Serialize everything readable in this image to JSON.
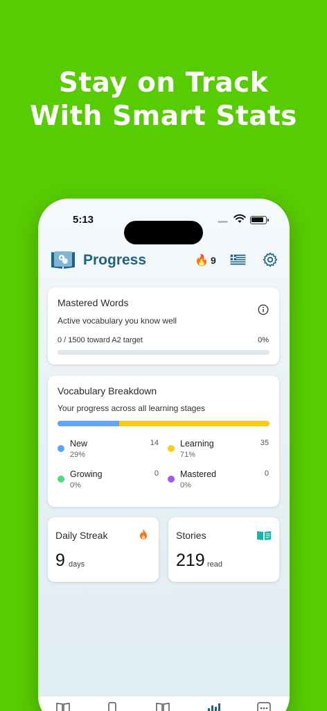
{
  "headline": {
    "line1": "Stay on Track",
    "line2": "With Smart Stats"
  },
  "status_bar": {
    "time": "5:13",
    "signal": "•••••"
  },
  "app_bar": {
    "title": "Progress",
    "streak_count": "9"
  },
  "mastered": {
    "title": "Mastered Words",
    "subtitle": "Active vocabulary you know well",
    "progress_text": "0 / 1500 toward A2 target",
    "percent_text": "0%",
    "progress_fraction": 0
  },
  "breakdown": {
    "title": "Vocabulary Breakdown",
    "subtitle": "Your progress across all learning stages",
    "segments": [
      {
        "label": "New",
        "count": "14",
        "percent": "29%",
        "fraction": 0.29,
        "color": "#60a5fa"
      },
      {
        "label": "Learning",
        "count": "35",
        "percent": "71%",
        "fraction": 0.71,
        "color": "#facc15"
      },
      {
        "label": "Growing",
        "count": "0",
        "percent": "0%",
        "fraction": 0,
        "color": "#4ade80"
      },
      {
        "label": "Mastered",
        "count": "0",
        "percent": "0%",
        "fraction": 0,
        "color": "#a855f7"
      }
    ]
  },
  "daily_streak": {
    "title": "Daily Streak",
    "value": "9",
    "unit": "days"
  },
  "stories": {
    "title": "Stories",
    "value": "219",
    "unit": "read"
  },
  "colors": {
    "brand_green": "#58cc02",
    "title_blue": "#1d6384",
    "icon_teal": "#0f766e",
    "streak_orange": "#f97316"
  }
}
